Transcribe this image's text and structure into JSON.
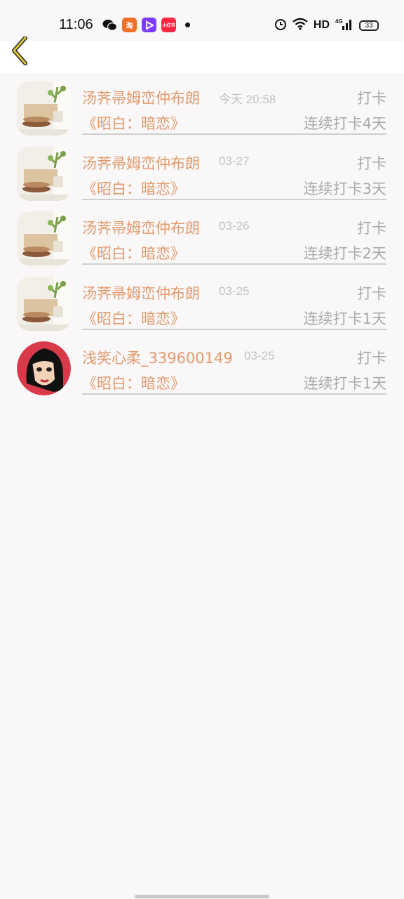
{
  "status_bar": {
    "time": "11:06",
    "network": "HD",
    "battery": "33",
    "apps": [
      {
        "icon": "wechat-icon",
        "label": "",
        "color": "#111111"
      },
      {
        "icon": "taobao-icon",
        "label": "淘",
        "color": "#f0702a"
      },
      {
        "icon": "video-app-icon",
        "label": "",
        "color": "#7b3cff"
      },
      {
        "icon": "xiaohongshu-icon",
        "label": "小红书",
        "color": "#ff2741"
      }
    ]
  },
  "entries": [
    {
      "name": "汤荠帚姆峦仲布朗",
      "date": "今天 20:58",
      "action": "打卡",
      "book": "《昭白：暗恋》",
      "streak": "连续打卡4天",
      "avatar": "still-life-icon"
    },
    {
      "name": "汤荠帚姆峦仲布朗",
      "date": "03-27",
      "action": "打卡",
      "book": "《昭白：暗恋》",
      "streak": "连续打卡3天",
      "avatar": "still-life-icon"
    },
    {
      "name": "汤荠帚姆峦仲布朗",
      "date": "03-26",
      "action": "打卡",
      "book": "《昭白：暗恋》",
      "streak": "连续打卡2天",
      "avatar": "still-life-icon"
    },
    {
      "name": "汤荠帚姆峦仲布朗",
      "date": "03-25",
      "action": "打卡",
      "book": "《昭白：暗恋》",
      "streak": "连续打卡1天",
      "avatar": "still-life-icon"
    },
    {
      "name": "浅笑心柔_339600149",
      "date": "03-25",
      "action": "打卡",
      "book": "《昭白：暗恋》",
      "streak": "连续打卡1天",
      "avatar": "cartoon-woman-icon"
    }
  ],
  "colors": {
    "accent": "#e39a6c",
    "muted": "#aaaaaa",
    "back_arrow": "#d9c63a"
  }
}
